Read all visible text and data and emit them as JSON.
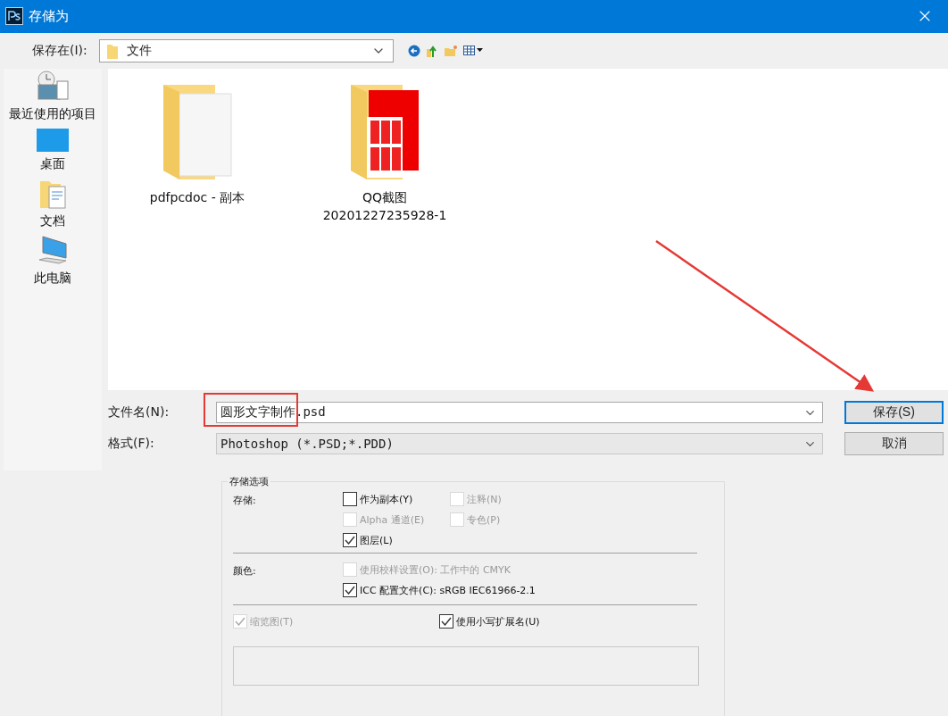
{
  "window": {
    "title": "存储为"
  },
  "save_in": {
    "label": "保存在(I):",
    "value": "文件"
  },
  "places": [
    {
      "label": "最近使用的项目",
      "kind": "recent"
    },
    {
      "label": "桌面",
      "kind": "desktop"
    },
    {
      "label": "文档",
      "kind": "documents"
    },
    {
      "label": "此电脑",
      "kind": "computer"
    }
  ],
  "files": [
    {
      "lines": [
        "pdfpcdoc - 副本"
      ],
      "kind": "blank"
    },
    {
      "lines": [
        "QQ截图",
        "20201227235928-1"
      ],
      "kind": "photos"
    }
  ],
  "file_name": {
    "label": "文件名(N):",
    "value": "圆形文字制作.psd"
  },
  "format": {
    "label": "格式(F):",
    "value": "Photoshop (*.PSD;*.PDD)"
  },
  "buttons": [
    {
      "label": "保存(S)",
      "default": true
    },
    {
      "label": "取消",
      "default": false
    }
  ],
  "options": {
    "title": "存储选项",
    "sections": [
      {
        "label": "存储:",
        "kind": "grid",
        "items": [
          {
            "label": "作为副本(Y)",
            "checked": false,
            "disabled": false
          },
          {
            "label": "注释(N)",
            "checked": false,
            "disabled": true
          },
          {
            "label": "Alpha 通道(E)",
            "checked": false,
            "disabled": true
          },
          {
            "label": "专色(P)",
            "checked": false,
            "disabled": true
          },
          {
            "label": "图层(L)",
            "checked": true,
            "disabled": false
          }
        ]
      },
      {
        "label": "颜色:",
        "kind": "list",
        "items": [
          {
            "label": "使用校样设置(O):  工作中的 CMYK",
            "checked": false,
            "disabled": true
          },
          {
            "label": "ICC 配置文件(C):  sRGB IEC61966-2.1",
            "checked": true,
            "disabled": false
          }
        ]
      },
      {
        "kind": "inline",
        "items": [
          {
            "label": "缩览图(T)",
            "checked": true,
            "disabled": true
          },
          {
            "label": "使用小写扩展名(U)",
            "checked": true,
            "disabled": false
          }
        ]
      }
    ]
  }
}
